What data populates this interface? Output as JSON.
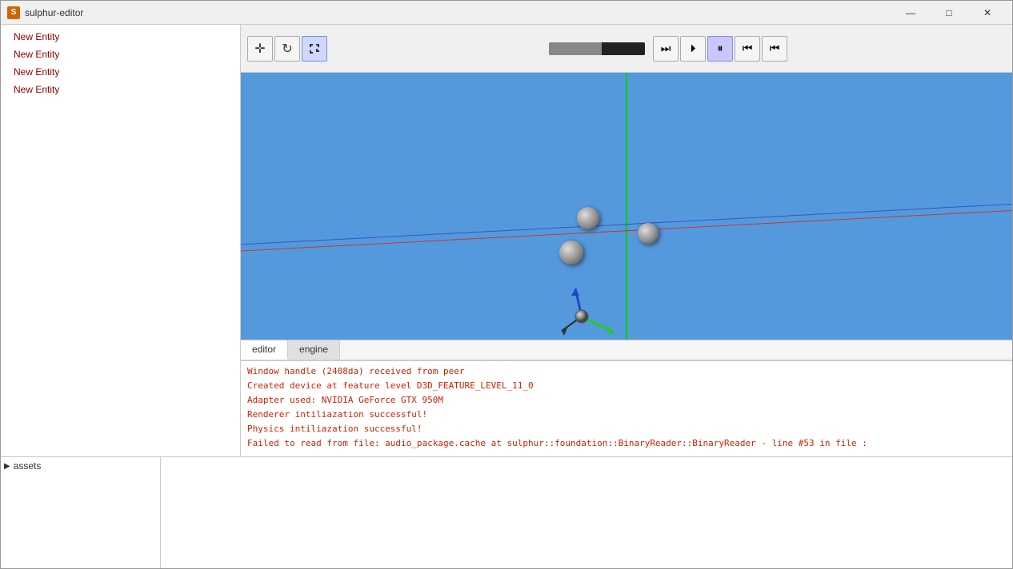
{
  "titleBar": {
    "icon": "S",
    "title": "sulphur-editor",
    "minimizeLabel": "—",
    "maximizeLabel": "□",
    "closeLabel": "✕"
  },
  "entityList": {
    "items": [
      {
        "label": "New Entity"
      },
      {
        "label": "New Entity"
      },
      {
        "label": "New Entity"
      },
      {
        "label": "New Entity"
      }
    ]
  },
  "toolbar": {
    "tools": [
      {
        "name": "move",
        "icon": "✛"
      },
      {
        "name": "refresh",
        "icon": "↻"
      },
      {
        "name": "fullscreen",
        "icon": "⛶"
      }
    ],
    "transport": [
      {
        "name": "play-end",
        "icon": "⏭"
      },
      {
        "name": "step-forward",
        "icon": "⏵"
      },
      {
        "name": "pause",
        "icon": "⏸",
        "active": true
      },
      {
        "name": "step-back",
        "icon": "⏮"
      },
      {
        "name": "skip-back",
        "icon": "⏮⏮"
      }
    ]
  },
  "tabs": [
    {
      "label": "editor",
      "active": true
    },
    {
      "label": "engine",
      "active": false
    }
  ],
  "console": {
    "lines": [
      "Window handle (2408da) received from peer",
      "Created device at feature level D3D_FEATURE_LEVEL_11_0",
      "Adapter used: NVIDIA GeForce GTX 950M",
      "Renderer intiliazation successful!",
      "Physics intiliazation successful!",
      "Failed to read from file: audio_package.cache at sulphur::foundation::BinaryReader::BinaryReader - line #53 in file :"
    ]
  },
  "bottomPanel": {
    "assetsLabel": "assets",
    "chevron": "▶"
  },
  "colors": {
    "viewportBg": "#5fa8e0",
    "entityText": "#8b0000"
  }
}
